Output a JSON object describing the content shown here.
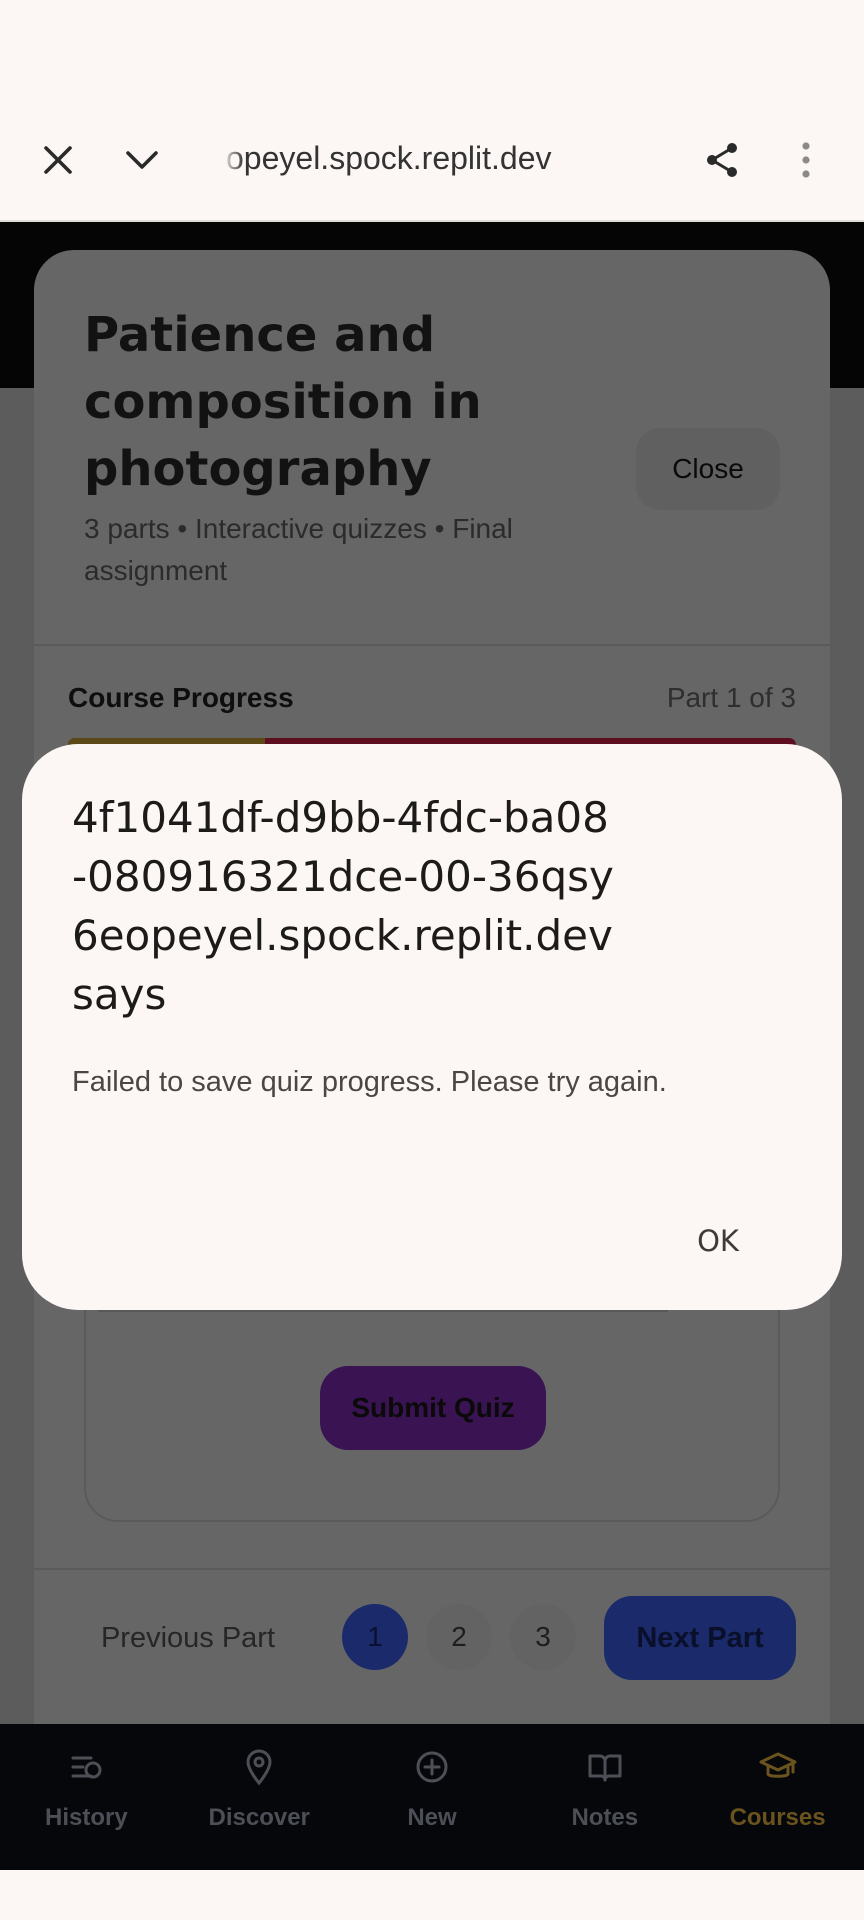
{
  "browser": {
    "url": "opeyel.spock.replit.dev",
    "close_icon": "close-icon",
    "collapse_icon": "chevron-down-icon",
    "share_icon": "share-icon",
    "menu_icon": "more-vert-icon"
  },
  "course": {
    "title": "Patience and composition in photography",
    "subtitle": "3 parts • Interactive quizzes • Final assignment",
    "close_label": "Close",
    "progress_label": "Course Progress",
    "progress_part": "Part 1 of 3",
    "progress_fraction": 0.27,
    "submit_label": "Submit Quiz",
    "prev_label": "Previous Part",
    "next_label": "Next Part",
    "pages": [
      "1",
      "2",
      "3"
    ],
    "active_page": "1"
  },
  "dialog": {
    "title_lines": [
      "4f1041df-d9bb-4fdc-ba08",
      "-080916321dce-00-36qsy",
      "6eopeyel.spock.replit.dev",
      "says"
    ],
    "message": "Failed to save quiz progress. Please try again.",
    "ok_label": "OK"
  },
  "nav": {
    "items": [
      {
        "label": "History",
        "icon": "history-icon"
      },
      {
        "label": "Discover",
        "icon": "location-pin-icon"
      },
      {
        "label": "New",
        "icon": "add-circle-icon"
      },
      {
        "label": "Notes",
        "icon": "book-icon"
      },
      {
        "label": "Courses",
        "icon": "graduation-cap-icon"
      }
    ],
    "active": "Courses"
  },
  "colors": {
    "accent_active_nav": "#6b531e",
    "dialog_bg": "#fcf7f4",
    "scrim_page_bg": "#5c5c5c"
  }
}
